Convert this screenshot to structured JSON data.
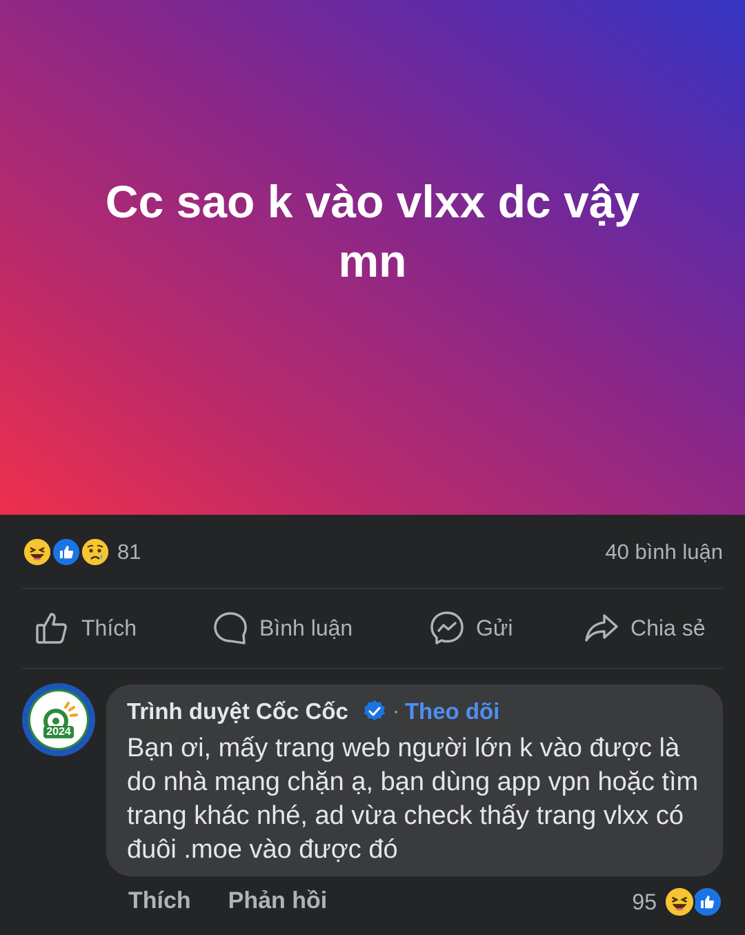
{
  "post": {
    "text": "Cc sao k vào vlxx dc vậy mn",
    "background_colors": [
      "#ee2f4c",
      "#8a2789",
      "#3436c4"
    ]
  },
  "stats": {
    "reactions": [
      "haha-icon",
      "like-icon",
      "sad-icon"
    ],
    "reaction_count": "81",
    "comment_count": "40 bình luận"
  },
  "actions": {
    "like": "Thích",
    "comment": "Bình luận",
    "send": "Gửi",
    "share": "Chia sẻ"
  },
  "comment": {
    "author": "Trình duyệt Cốc Cốc",
    "verified": true,
    "separator": "·",
    "follow": "Theo dõi",
    "avatar_year": "2024",
    "text": "Bạn ơi, mấy trang web người lớn k vào được là do nhà mạng chặn ạ, bạn dùng app vpn hoặc tìm trang khác nhé, ad vừa check thấy trang vlxx có đuôi .moe vào được đó",
    "like": "Thích",
    "reply": "Phản hồi",
    "reaction_count": "95",
    "reactions": [
      "haha-icon",
      "like-icon"
    ]
  },
  "colors": {
    "background": "#242526",
    "bubble": "#3a3b3c",
    "link": "#4e8ff2",
    "muted": "#b0b3b8"
  }
}
